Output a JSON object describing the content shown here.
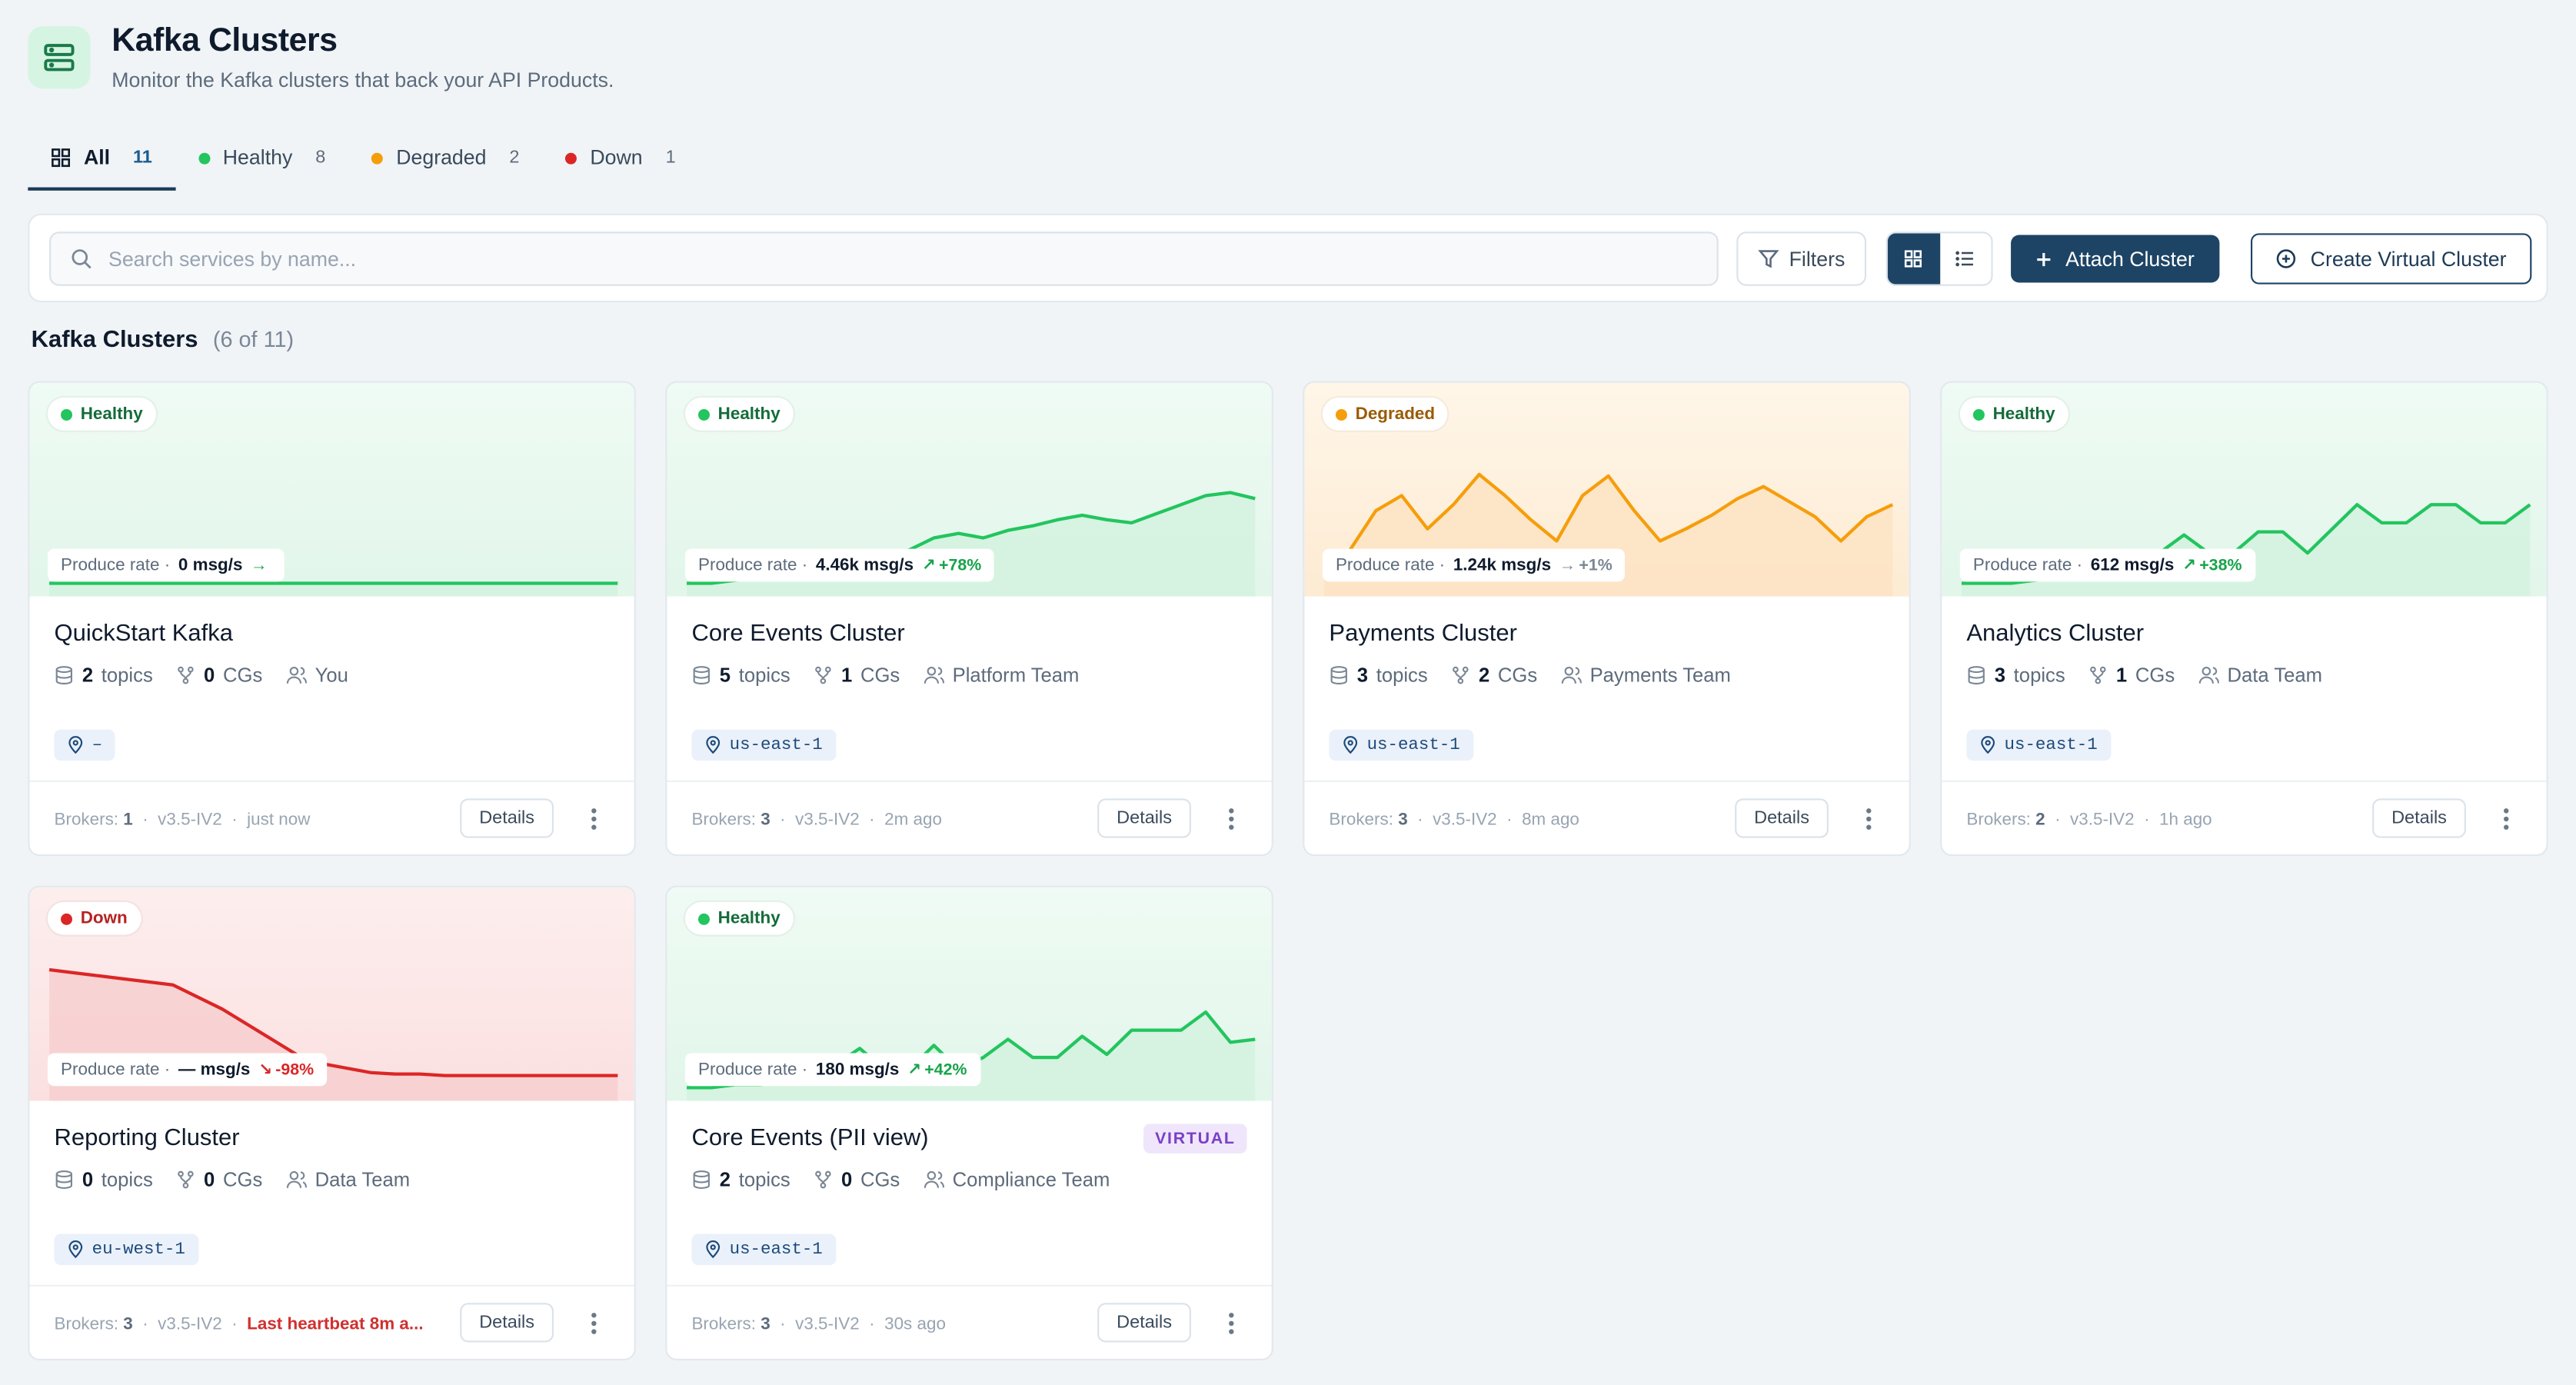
{
  "header": {
    "title": "Kafka Clusters",
    "subtitle": "Monitor the Kafka clusters that back your API Products."
  },
  "tabs": [
    {
      "label": "All",
      "count": "11"
    },
    {
      "label": "Healthy",
      "count": "8"
    },
    {
      "label": "Degraded",
      "count": "2"
    },
    {
      "label": "Down",
      "count": "1"
    }
  ],
  "toolbar": {
    "search_placeholder": "Search services by name...",
    "filters_label": "Filters",
    "attach_label": "Attach Cluster",
    "virtual_label": "Create Virtual Cluster"
  },
  "section": {
    "title": "Kafka Clusters",
    "count": "(6 of 11)"
  },
  "colors": {
    "healthy": "#22c55e",
    "degraded": "#f59e0b",
    "down": "#dc2626",
    "primary": "#1d4465"
  },
  "labels": {
    "produce_rate": "Produce rate ·",
    "topics": "topics",
    "cgs": "CGs",
    "details": "Details",
    "brokers": "Brokers:",
    "virtual": "VIRTUAL"
  },
  "clusters": [
    {
      "status": "Healthy",
      "kind": "healthy",
      "rate": "0 msg/s",
      "delta_icon": "→",
      "delta": "",
      "name": "QuickStart Kafka",
      "topics": "2",
      "cgs": "0",
      "owner": "You",
      "region": "–",
      "brokers": "1",
      "version": "v3.5-IV2",
      "updated": "just now",
      "warn": false,
      "series": [
        0,
        0,
        0,
        0,
        0,
        0,
        0,
        0,
        0,
        0,
        0,
        0,
        0,
        0,
        0,
        0,
        0,
        0,
        0,
        0,
        0,
        0,
        0
      ]
    },
    {
      "status": "Healthy",
      "kind": "healthy",
      "rate": "4.46k msg/s",
      "delta_icon": "↗",
      "delta": "+78%",
      "name": "Core Events Cluster",
      "topics": "5",
      "cgs": "1",
      "owner": "Platform Team",
      "region": "us-east-1",
      "brokers": "3",
      "version": "v3.5-IV2",
      "updated": "2m ago",
      "warn": false,
      "series": [
        0,
        0,
        0.02,
        0.05,
        0.1,
        0.14,
        0.08,
        0.12,
        0.18,
        0.22,
        0.3,
        0.33,
        0.3,
        0.35,
        0.38,
        0.42,
        0.45,
        0.42,
        0.4,
        0.46,
        0.52,
        0.58,
        0.6,
        0.56
      ]
    },
    {
      "status": "Degraded",
      "kind": "degraded",
      "rate": "1.24k msg/s",
      "delta_icon": "→",
      "delta": "+1%",
      "name": "Payments Cluster",
      "topics": "3",
      "cgs": "2",
      "owner": "Payments Team",
      "region": "us-east-1",
      "brokers": "3",
      "version": "v3.5-IV2",
      "updated": "8m ago",
      "warn": false,
      "series": [
        0.05,
        0.22,
        0.48,
        0.58,
        0.36,
        0.52,
        0.72,
        0.58,
        0.42,
        0.28,
        0.58,
        0.71,
        0.48,
        0.28,
        0.36,
        0.45,
        0.56,
        0.64,
        0.54,
        0.44,
        0.28,
        0.44,
        0.52
      ]
    },
    {
      "status": "Healthy",
      "kind": "healthy",
      "rate": "612 msg/s",
      "delta_icon": "↗",
      "delta": "+38%",
      "name": "Analytics Cluster",
      "topics": "3",
      "cgs": "1",
      "owner": "Data Team",
      "region": "us-east-1",
      "brokers": "2",
      "version": "v3.5-IV2",
      "updated": "1h ago",
      "warn": false,
      "series": [
        0,
        0,
        0,
        0.02,
        0.05,
        0.15,
        0.05,
        0.05,
        0.2,
        0.32,
        0.2,
        0.2,
        0.34,
        0.34,
        0.2,
        0.36,
        0.52,
        0.4,
        0.4,
        0.52,
        0.52,
        0.4,
        0.4,
        0.52
      ]
    },
    {
      "status": "Down",
      "kind": "down",
      "rate": "— msg/s",
      "delta_icon": "↘",
      "delta": "-98%",
      "name": "Reporting Cluster",
      "topics": "0",
      "cgs": "0",
      "owner": "Data Team",
      "region": "eu-west-1",
      "brokers": "3",
      "version": "v3.5-IV2",
      "updated": "Last heartbeat 8m a...",
      "warn": true,
      "series": [
        0.78,
        0.76,
        0.74,
        0.72,
        0.7,
        0.68,
        0.6,
        0.52,
        0.42,
        0.32,
        0.22,
        0.16,
        0.13,
        0.1,
        0.09,
        0.09,
        0.08,
        0.08,
        0.08,
        0.08,
        0.08,
        0.08,
        0.08,
        0.08
      ]
    },
    {
      "status": "Healthy",
      "kind": "healthy",
      "rate": "180 msg/s",
      "delta_icon": "↗",
      "delta": "+42%",
      "name": "Core Events (PII view)",
      "topics": "2",
      "cgs": "0",
      "owner": "Compliance Team",
      "region": "us-east-1",
      "brokers": "3",
      "version": "v3.5-IV2",
      "updated": "30s ago",
      "warn": false,
      "virtual": true,
      "series": [
        0,
        0,
        0.02,
        0.02,
        0.05,
        0.05,
        0.15,
        0.26,
        0.12,
        0.12,
        0.28,
        0.12,
        0.2,
        0.32,
        0.2,
        0.2,
        0.34,
        0.22,
        0.38,
        0.38,
        0.38,
        0.5,
        0.3,
        0.32
      ]
    }
  ]
}
